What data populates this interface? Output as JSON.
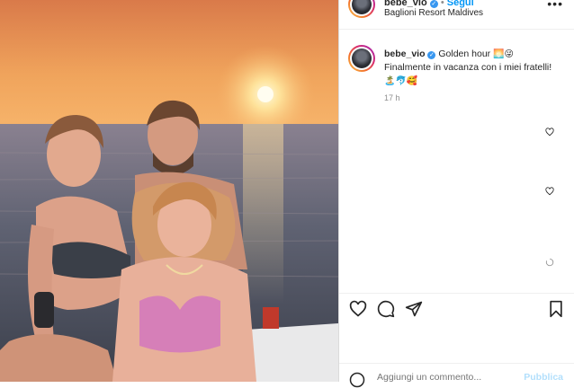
{
  "post": {
    "username": "bebe_vio",
    "dot": "•",
    "follow": "Segui",
    "location": "Baglioni Resort Maldives",
    "more": "•••",
    "caption_text": "Golden hour",
    "caption_emoji_1": "🌅😜",
    "caption_line2": "Finalmente in vacanza con i miei fratelli!",
    "caption_emoji_2": "🏝️🐬🥰",
    "time": "17 h"
  },
  "actions": {
    "like": "heart-outline-icon",
    "comment": "comment-bubble-icon",
    "share": "paper-plane-icon",
    "save": "bookmark-icon"
  },
  "comment_box": {
    "placeholder": "Aggiungi un commento...",
    "publish": "Pubblica"
  },
  "colors": {
    "link": "#0095f6",
    "verified": "#3897f0",
    "publish_disabled": "#b2dffc",
    "sky_top": "#e58a55",
    "sun": "#fff4c0",
    "sea": "#4a4f5c"
  }
}
